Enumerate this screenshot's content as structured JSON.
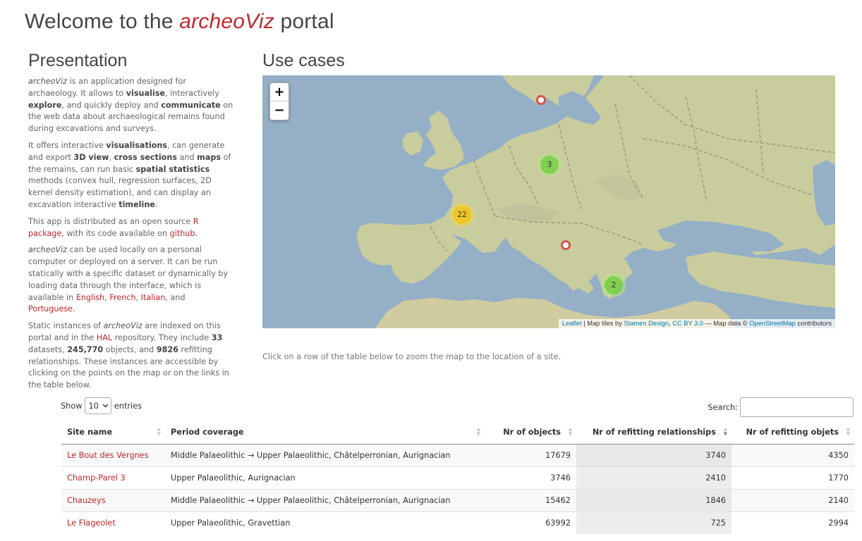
{
  "header": {
    "title_prefix": "Welcome to the",
    "title_brand": "archeoViz",
    "title_suffix": "portal"
  },
  "presentation": {
    "heading": "Presentation",
    "p1": {
      "brand": "archeoViz",
      "t1": " is an application designed for archaeology. It allows to ",
      "b1": "visualise",
      "t2": ", interactively ",
      "b2": "explore",
      "t3": ", and quickly deploy and ",
      "b3": "communicate",
      "t4": " on the web data about archaeological remains found during excavations and surveys."
    },
    "p2": {
      "t1": "It offers interactive ",
      "b1": "visualisations",
      "t2": ", can generate and export ",
      "b2": "3D view",
      "t3": ", ",
      "b3": "cross sections",
      "t4": " and ",
      "b4": "maps",
      "t5": " of the remains, can run basic ",
      "b5": "spatial statistics",
      "t6": " methods (convex hull, regression surfaces, 2D kernel density estimation), and can display an excavation interactive ",
      "b6": "timeline",
      "t7": "."
    },
    "p3": {
      "t1": "This app is distributed as an open source ",
      "link1": "R package",
      "t2": ", with its code available on ",
      "link2": "github",
      "t3": "."
    },
    "p4": {
      "brand": "archeoViz",
      "t1": " can be used locally on a personal computer or deployed on a server. It can be run statically with a specific dataset or dynamically by loading data through the interface, which is available in ",
      "l1": "English",
      "s1": ", ",
      "l2": "French",
      "s2": ", ",
      "l3": "Italian",
      "s3": ", and ",
      "l4": "Portuguese",
      "t2": "."
    },
    "p5": {
      "t1": "Static instances of ",
      "brand": "archeoViz",
      "t2": " are indexed on this portal and in the ",
      "link1": "HAL",
      "t3": " repository. They include ",
      "n1": "33",
      "t4": " datasets, ",
      "n2": "245,770",
      "t5": " objects, and ",
      "n3": "9826",
      "t6": " refitting relationships. These instances are accessible by clicking on the points on the map or on the links in the table below."
    }
  },
  "use_cases": {
    "heading": "Use cases",
    "map": {
      "zoom_in": "+",
      "zoom_out": "−",
      "clusters": [
        {
          "count": "3",
          "color": "green"
        },
        {
          "count": "22",
          "color": "yellow"
        },
        {
          "count": "2",
          "color": "green"
        }
      ],
      "attribution": {
        "leaflet": "Leaflet",
        "sep1": " | Map tiles by ",
        "stamen": "Stamen Design",
        "sep2": ", ",
        "cc": "CC BY 3.0",
        "sep3": " — Map data © ",
        "osm": "OpenStreetMap",
        "sep4": " contributors"
      }
    },
    "hint": "Click on a row of the table below to zoom the map to the location of a site."
  },
  "table_controls": {
    "show_label": "Show",
    "page_length": "10",
    "entries_label": "entries",
    "search_label": "Search:"
  },
  "table": {
    "columns": [
      "Site name",
      "Period coverage",
      "Nr of objects",
      "Nr of refitting relationships",
      "Nr of refitting objets"
    ],
    "sorted_column": "Nr of refitting relationships",
    "sort_direction": "descending",
    "rows": [
      {
        "site": "Le Bout des Vergnes",
        "period": "Middle Palaeolithic → Upper Palaeolithic, Châtelperronian, Aurignacian",
        "objects": "17679",
        "relationships": "3740",
        "refit_objects": "4350"
      },
      {
        "site": "Champ-Parel 3",
        "period": "Upper Palaeolithic, Aurignacian",
        "objects": "3746",
        "relationships": "2410",
        "refit_objects": "1770"
      },
      {
        "site": "Chauzeys",
        "period": "Middle Palaeolithic → Upper Palaeolithic, Châtelperronian, Aurignacian",
        "objects": "15462",
        "relationships": "1846",
        "refit_objects": "2140"
      },
      {
        "site": "Le Flageolet",
        "period": "Upper Palaeolithic, Gravettian",
        "objects": "63992",
        "relationships": "725",
        "refit_objects": "2994"
      }
    ]
  }
}
